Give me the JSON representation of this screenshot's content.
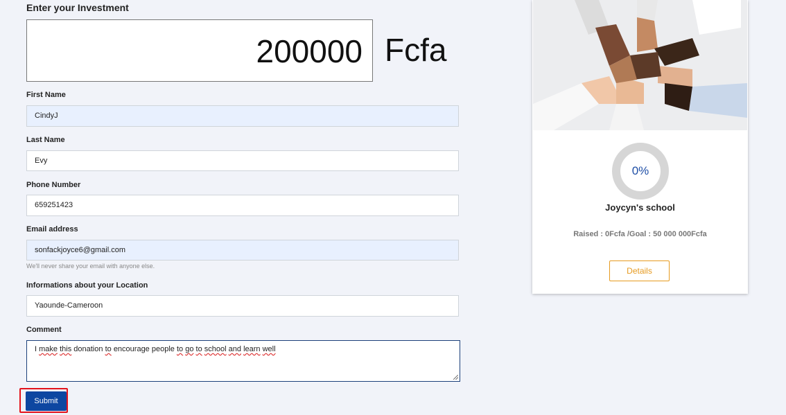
{
  "investment": {
    "title": "Enter your Investment",
    "amount": "200000",
    "currency": "Fcfa"
  },
  "form": {
    "first_name": {
      "label": "First Name",
      "value": "CindyJ"
    },
    "last_name": {
      "label": "Last Name",
      "value": "Evy"
    },
    "phone": {
      "label": "Phone Number",
      "value": "659251423"
    },
    "email": {
      "label": "Email address",
      "value": "sonfackjoyce6@gmail.com",
      "help": "We'll never share your email with anyone else."
    },
    "location": {
      "label": "Informations about your Location",
      "value": "Yaounde-Cameroon"
    },
    "comment": {
      "label": "Comment",
      "words": [
        "I",
        "make",
        "this",
        "donation",
        "to",
        "encourage",
        "people",
        "to",
        "go",
        "to",
        "school",
        "and",
        "learn",
        "well"
      ]
    },
    "submit_label": "Submit"
  },
  "campaign": {
    "progress_percent": 0,
    "progress_label": "0%",
    "title": "Joycyn's school",
    "raised_text": "Raised : 0Fcfa /Goal : 50 000 000Fcfa",
    "details_label": "Details"
  },
  "colors": {
    "page_background": "#f1f3f9",
    "primary_button": "#0d47a1",
    "details_accent": "#e69a1f",
    "progress_track": "#d6d6d6",
    "progress_text": "#1f4fa6",
    "highlight": "#e3121b"
  }
}
